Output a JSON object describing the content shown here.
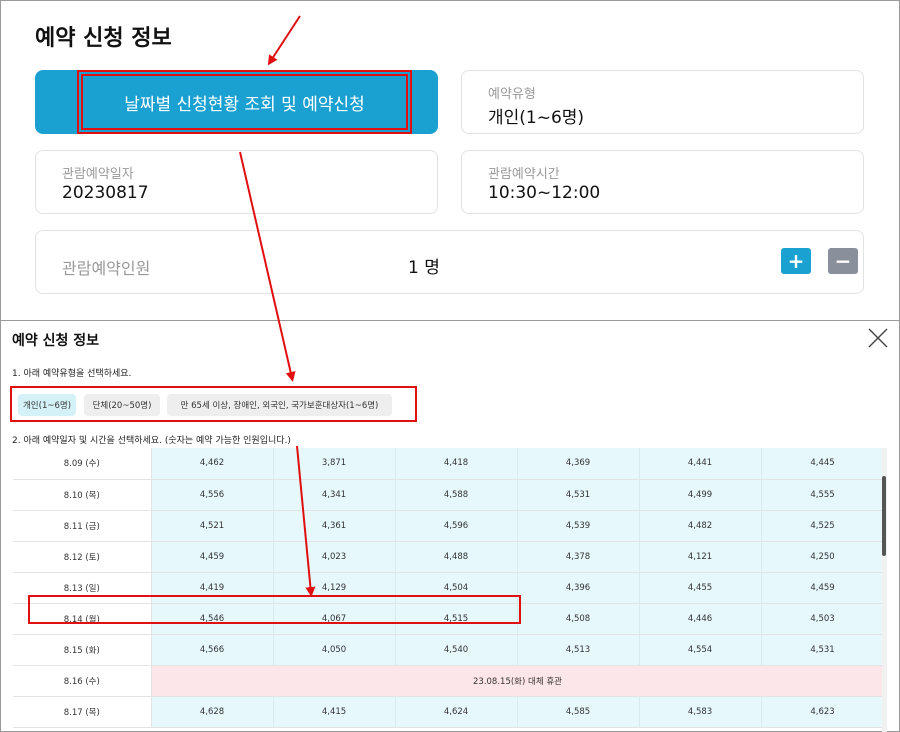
{
  "top": {
    "title": "예약 신청 정보",
    "date_button_label": "날짜별 신청현황 조회 및 예약신청",
    "reservation_type": {
      "label": "예약유형",
      "value": "개인(1~6명)"
    },
    "visit_date": {
      "label": "관람예약일자",
      "value": "20230817"
    },
    "visit_time": {
      "label": "관람예약시간",
      "value": "10:30~12:00"
    },
    "people": {
      "label": "관람예약인원",
      "count": "1 명",
      "plus": "+",
      "minus": "−"
    }
  },
  "modal": {
    "title": "예약 신청 정보",
    "step1": "1. 아래 예약유형을 선택하세요.",
    "types": [
      "개인(1~6명)",
      "단체(20~50명)",
      "만 65세 이상, 장애인, 외국인, 국가보훈대상자(1~6명)"
    ],
    "step2": "2. 아래 예약일자 및 시간을 선택하세요. (숫자는 예약 가능한 인원입니다.)",
    "rows": [
      {
        "date": "8.09 (수)",
        "cells": [
          "4,462",
          "3,871",
          "4,418",
          "4,369",
          "4,441",
          "4,445"
        ]
      },
      {
        "date": "8.10 (목)",
        "cells": [
          "4,556",
          "4,341",
          "4,588",
          "4,531",
          "4,499",
          "4,555"
        ]
      },
      {
        "date": "8.11 (금)",
        "cells": [
          "4,521",
          "4,361",
          "4,596",
          "4,539",
          "4,482",
          "4,525"
        ]
      },
      {
        "date": "8.12 (토)",
        "cells": [
          "4,459",
          "4,023",
          "4,488",
          "4,378",
          "4,121",
          "4,250"
        ]
      },
      {
        "date": "8.13 (일)",
        "cells": [
          "4,419",
          "4,129",
          "4,504",
          "4,396",
          "4,455",
          "4,459"
        ]
      },
      {
        "date": "8.14 (월)",
        "cells": [
          "4,546",
          "4,067",
          "4,515",
          "4,508",
          "4,446",
          "4,503"
        ]
      },
      {
        "date": "8.15 (화)",
        "cells": [
          "4,566",
          "4,050",
          "4,540",
          "4,513",
          "4,554",
          "4,531"
        ]
      },
      {
        "date": "8.16 (수)",
        "holiday": "23.08.15(화) 대체 휴관"
      },
      {
        "date": "8.17 (목)",
        "cells": [
          "4,628",
          "4,415",
          "4,624",
          "4,585",
          "4,583",
          "4,623"
        ]
      }
    ]
  },
  "colors": {
    "accent": "#1ba1d1",
    "highlight": "#e01010",
    "cell": "#e6f8fc",
    "holiday": "#fde6ea"
  }
}
